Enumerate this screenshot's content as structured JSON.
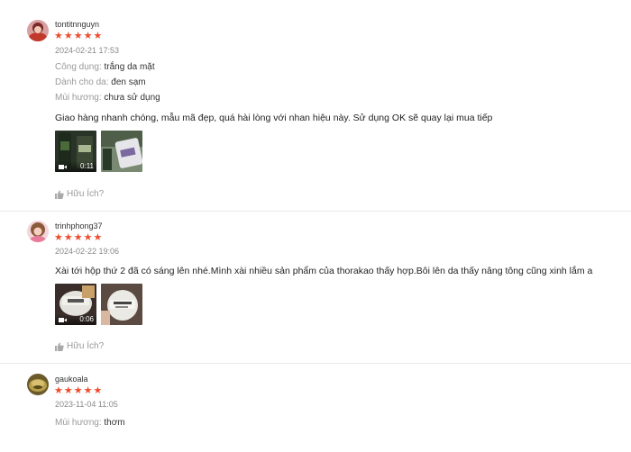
{
  "reviews": [
    {
      "username": "tontitnnguyn",
      "stars": "★★★★★",
      "date": "2024-02-21 17:53",
      "attributes": [
        {
          "key": "Công dụng:",
          "value": "trắng da mặt"
        },
        {
          "key": "Dành cho da:",
          "value": "đen sạm"
        },
        {
          "key": "Mùi hương:",
          "value": "chưa sử dụng"
        }
      ],
      "comment": "Giao hàng nhanh chóng, mẫu mã đẹp, quá hài lòng với nhan hiệu này. Sử dụng OK sẽ quay lại mua tiếp",
      "video_duration": "0:11",
      "helpful_label": "Hữu Ích?"
    },
    {
      "username": "trinhphong37",
      "stars": "★★★★★",
      "date": "2024-02-22 19:06",
      "comment": "Xài tới hộp thứ 2 đã có sáng lên nhé.Mình xài nhiều sản phẩm của thorakao thấy hợp.Bôi lên da thấy nâng tông cũng xinh lắm a",
      "video_duration": "0:06",
      "helpful_label": "Hữu Ích?"
    },
    {
      "username": "gaukoala",
      "stars": "★★★★★",
      "date": "2023-11-04 11:05",
      "attributes": [
        {
          "key": "Mùi hương:",
          "value": "thơm"
        }
      ]
    }
  ],
  "colors": {
    "star": "#ee4d2d",
    "label": "#999999",
    "text": "#222222"
  },
  "icons": {
    "helpful": "thumbs-up-icon",
    "video": "video-camera-icon"
  }
}
